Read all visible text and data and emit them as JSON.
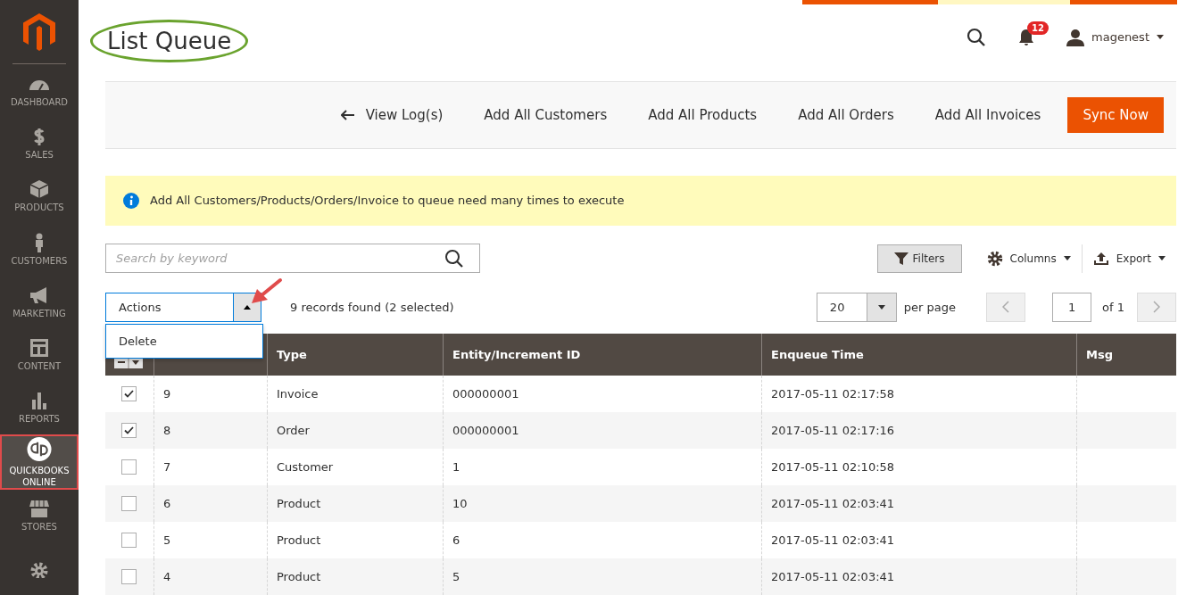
{
  "sidebar": {
    "items": [
      {
        "label": "DASHBOARD",
        "selected": false
      },
      {
        "label": "SALES",
        "selected": false
      },
      {
        "label": "PRODUCTS",
        "selected": false
      },
      {
        "label": "CUSTOMERS",
        "selected": false
      },
      {
        "label": "MARKETING",
        "selected": false
      },
      {
        "label": "CONTENT",
        "selected": false
      },
      {
        "label": "REPORTS",
        "selected": false
      },
      {
        "label": "QUICKBOOKS ONLINE",
        "selected": true
      },
      {
        "label": "STORES",
        "selected": false
      },
      {
        "selected": false
      }
    ]
  },
  "header": {
    "title": "List Queue",
    "notifications": "12",
    "user": "magenest"
  },
  "toolbar": {
    "back": "View Log(s)",
    "actions": [
      "Add All Customers",
      "Add All Products",
      "Add All Orders",
      "Add All Invoices"
    ],
    "primary": "Sync Now"
  },
  "notice": "Add All Customers/Products/Orders/Invoice to queue need many times to execute",
  "search": {
    "placeholder": "Search by keyword"
  },
  "grid_controls": {
    "filters": "Filters",
    "columns": "Columns",
    "export": "Export"
  },
  "mass_actions": {
    "label": "Actions",
    "expanded": true,
    "options": [
      "Delete"
    ],
    "records": "9 records found (2 selected)"
  },
  "pager": {
    "per_page_value": "20",
    "per_page_label": "per page",
    "page": "1",
    "of": "of 1"
  },
  "table": {
    "columns": [
      "Type",
      "Entity/Increment ID",
      "Enqueue Time",
      "Msg"
    ],
    "rows": [
      {
        "selected": true,
        "id": "9",
        "type": "Invoice",
        "entity": "000000001",
        "time": "2017-05-11 02:17:58"
      },
      {
        "selected": true,
        "id": "8",
        "type": "Order",
        "entity": "000000001",
        "time": "2017-05-11 02:17:16"
      },
      {
        "selected": false,
        "id": "7",
        "type": "Customer",
        "entity": "1",
        "time": "2017-05-11 02:10:58"
      },
      {
        "selected": false,
        "id": "6",
        "type": "Product",
        "entity": "10",
        "time": "2017-05-11 02:03:41"
      },
      {
        "selected": false,
        "id": "5",
        "type": "Product",
        "entity": "6",
        "time": "2017-05-11 02:03:41"
      },
      {
        "selected": false,
        "id": "4",
        "type": "Product",
        "entity": "5",
        "time": "2017-05-11 02:03:41"
      }
    ]
  }
}
